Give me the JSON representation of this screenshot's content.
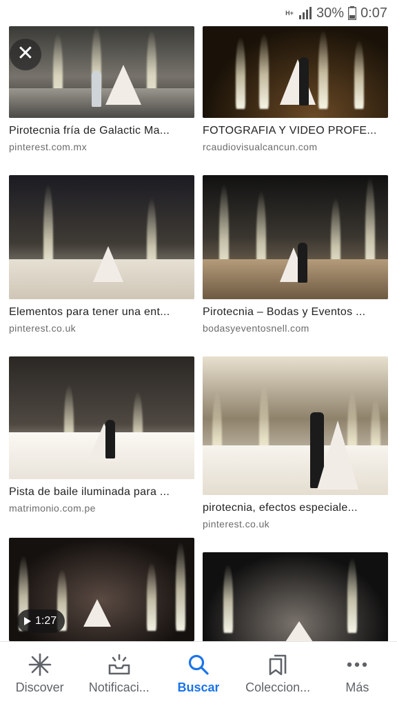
{
  "status_bar": {
    "network": "H+",
    "battery": "30%",
    "time": "0:07"
  },
  "results": [
    {
      "title": "Pirotecnia fría de Galactic Ma...",
      "source": "pinterest.com.mx"
    },
    {
      "title": "FOTOGRAFIA Y VIDEO PROFE...",
      "source": "rcaudiovisualcancun.com"
    },
    {
      "title": "Elementos para tener una ent...",
      "source": "pinterest.co.uk"
    },
    {
      "title": "Pirotecnia – Bodas y Eventos ...",
      "source": "bodasyeventosnell.com"
    },
    {
      "title": "Pista de baile iluminada para ...",
      "source": "matrimonio.com.pe"
    },
    {
      "title": "pirotecnia, efectos especiale...",
      "source": "pinterest.co.uk"
    },
    {
      "video_duration": "1:27"
    },
    {}
  ],
  "close_icon": "close-icon",
  "bottom_nav": [
    {
      "label": "Discover",
      "icon": "asterisk-icon"
    },
    {
      "label": "Notificaci...",
      "icon": "inbox-icon"
    },
    {
      "label": "Buscar",
      "icon": "search-icon",
      "active": true
    },
    {
      "label": "Coleccion...",
      "icon": "bookmarks-icon"
    },
    {
      "label": "Más",
      "icon": "more-dots-icon"
    }
  ],
  "colors": {
    "accent": "#1a73e8",
    "nav_inactive": "#5f6368"
  }
}
